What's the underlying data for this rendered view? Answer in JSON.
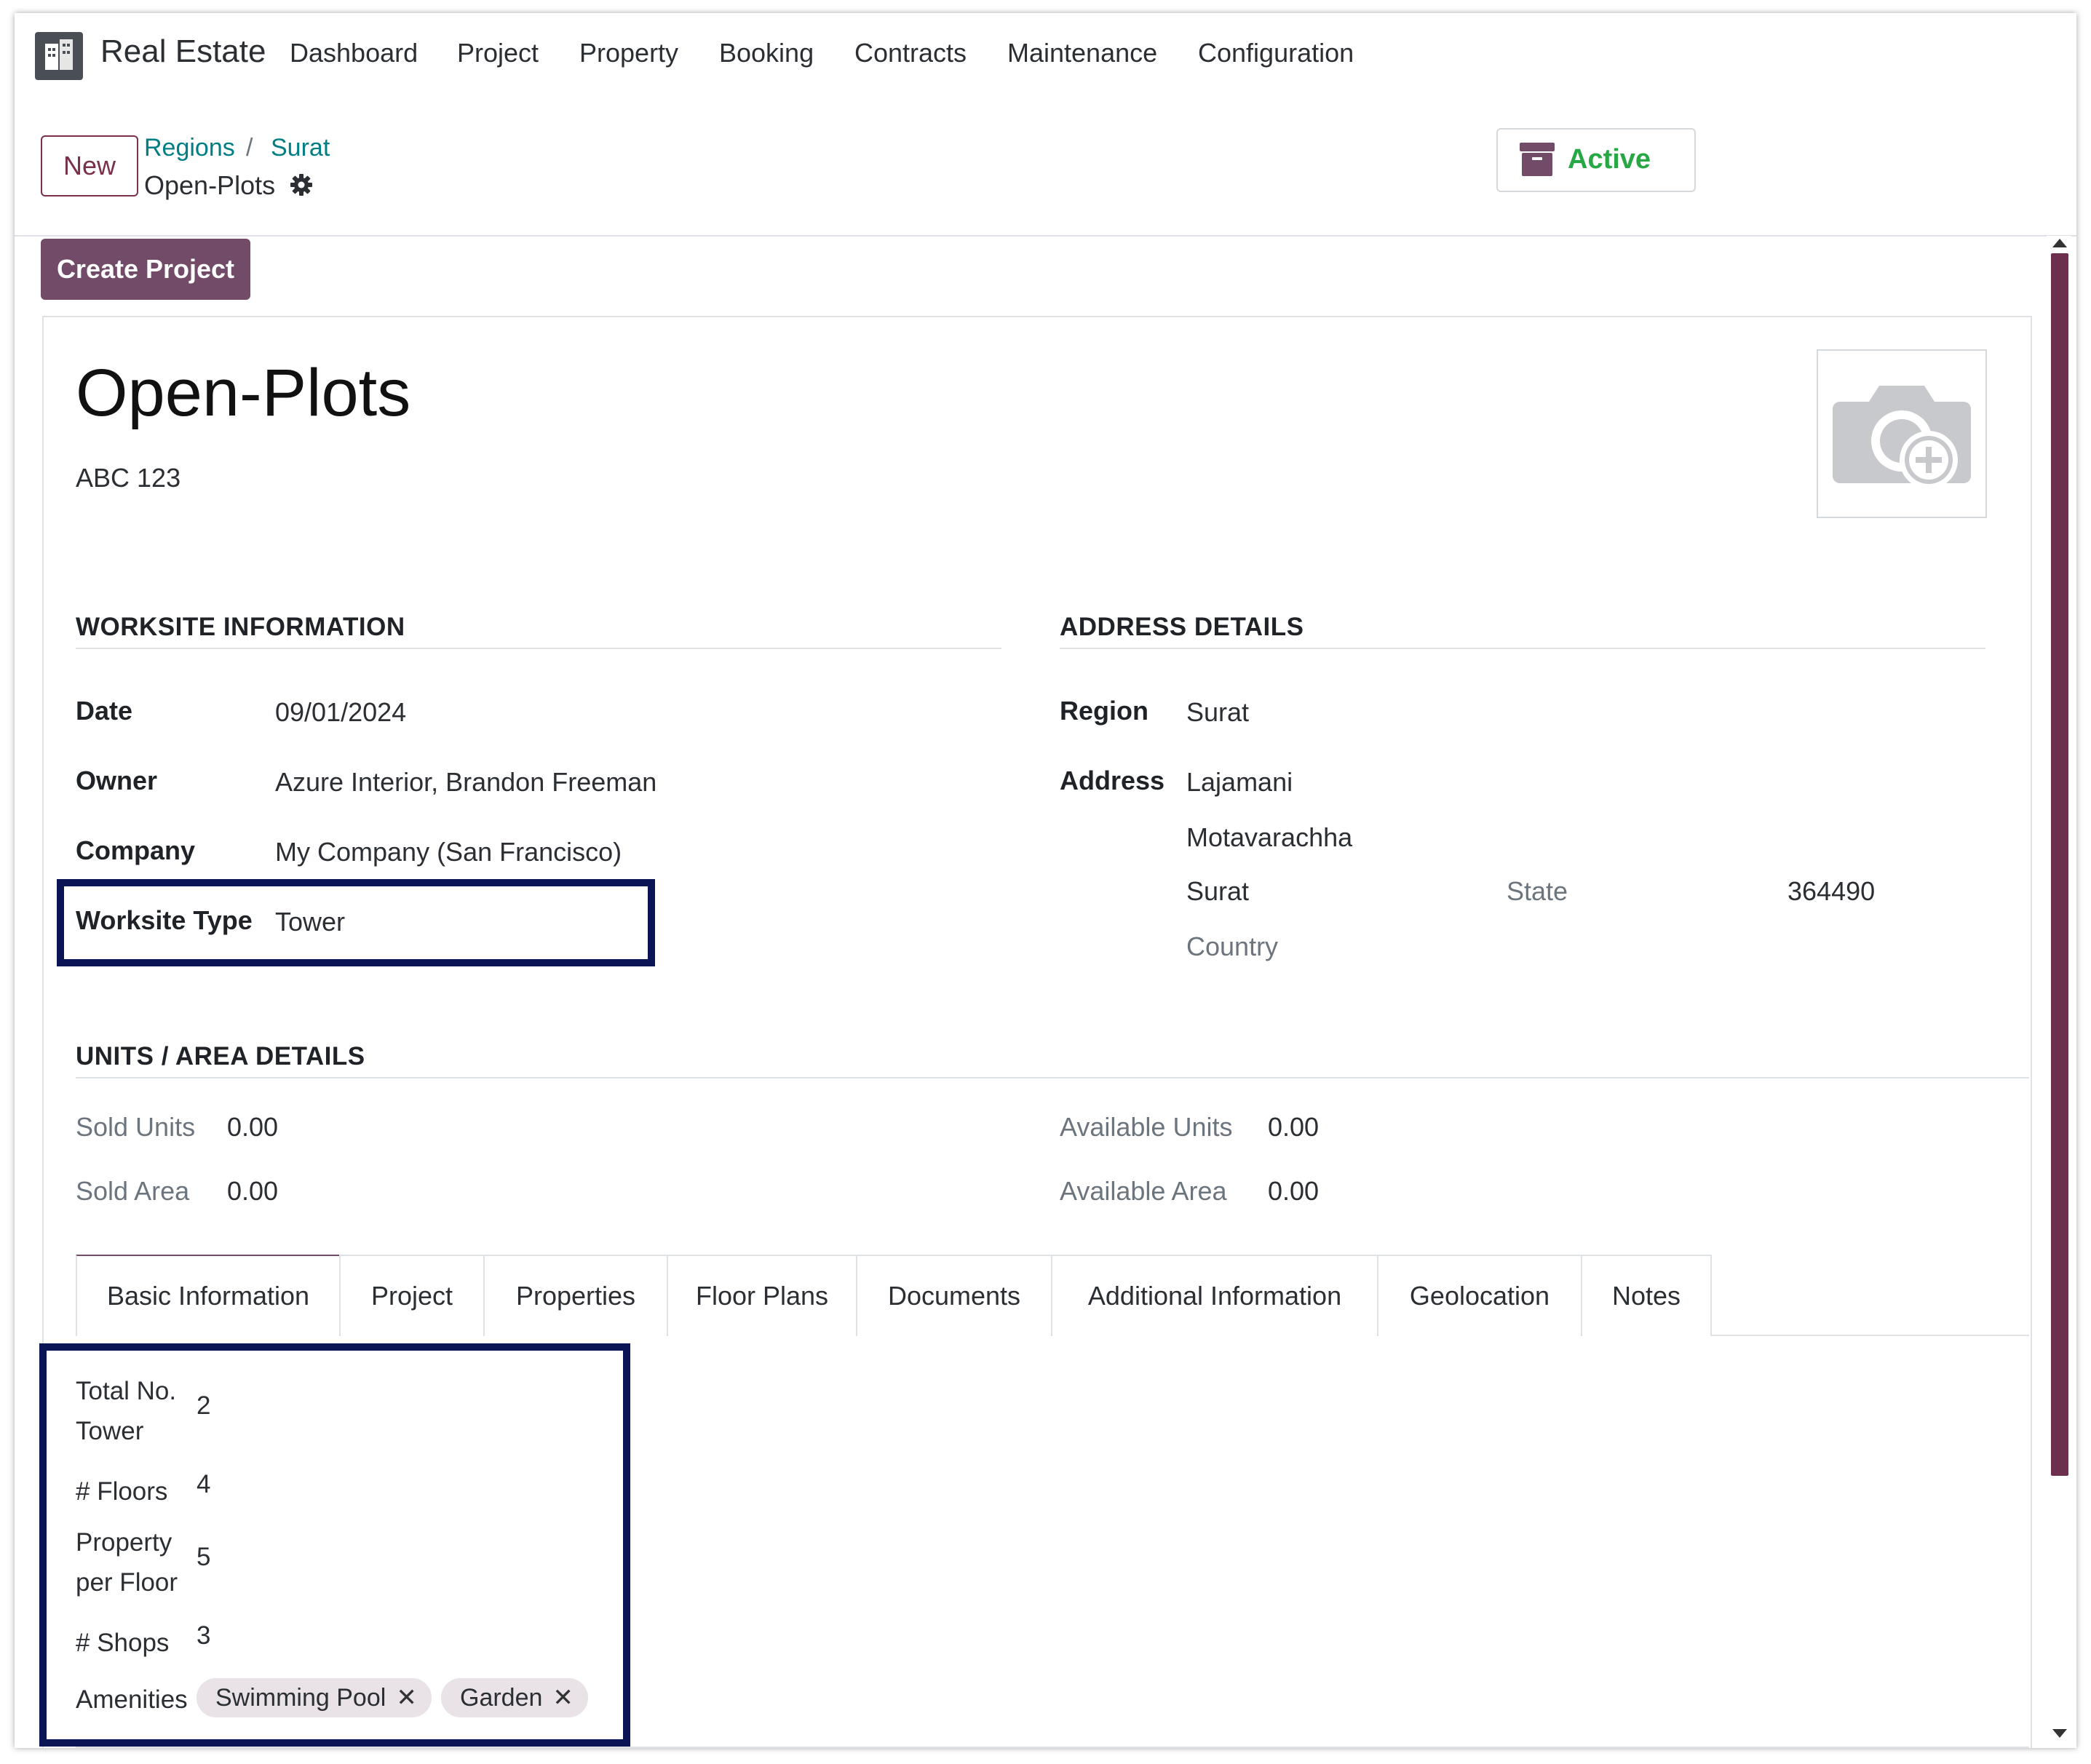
{
  "topnav": {
    "app_title": "Real Estate",
    "menu": [
      "Dashboard",
      "Project",
      "Property",
      "Booking",
      "Contracts",
      "Maintenance",
      "Configuration"
    ]
  },
  "control_panel": {
    "new_label": "New",
    "breadcrumbs": [
      "Regions",
      "Surat"
    ],
    "breadcrumb_sep": "/",
    "record_name": "Open-Plots",
    "status_label": "Active"
  },
  "actions": {
    "create_project": "Create Project"
  },
  "record": {
    "title": "Open-Plots",
    "reference": "ABC 123"
  },
  "worksite": {
    "section_title": "WORKSITE INFORMATION",
    "date_label": "Date",
    "date": "09/01/2024",
    "owner_label": "Owner",
    "owner": "Azure Interior, Brandon Freeman",
    "company_label": "Company",
    "company": "My Company (San Francisco)",
    "type_label": "Worksite Type",
    "type": "Tower"
  },
  "address": {
    "section_title": "ADDRESS DETAILS",
    "region_label": "Region",
    "region": "Surat",
    "address_label": "Address",
    "street": "Lajamani",
    "street2": "Motavarachha",
    "city": "Surat",
    "state_placeholder": "State",
    "zip": "364490",
    "country_placeholder": "Country"
  },
  "units": {
    "section_title": "UNITS / AREA DETAILS",
    "sold_units_label": "Sold Units",
    "sold_units": "0.00",
    "sold_area_label": "Sold Area",
    "sold_area": "0.00",
    "avail_units_label": "Available Units",
    "avail_units": "0.00",
    "avail_area_label": "Available Area",
    "avail_area": "0.00"
  },
  "tabs": [
    "Basic Information",
    "Project",
    "Properties",
    "Floor Plans",
    "Documents",
    "Additional Information",
    "Geolocation",
    "Notes"
  ],
  "basic_info": {
    "total_tower_label_1": "Total No.",
    "total_tower_label_2": "Tower",
    "total_tower": "2",
    "floors_label": "# Floors",
    "floors": "4",
    "ppf_label_1": "Property",
    "ppf_label_2": "per Floor",
    "ppf": "5",
    "shops_label": "# Shops",
    "shops": "3",
    "amenities_label": "Amenities",
    "amenities": [
      "Swimming Pool",
      "Garden"
    ]
  },
  "colors": {
    "brand": "#714b67",
    "link": "#017e84",
    "active": "#28a745",
    "highlight": "#0b1454"
  },
  "icons": [
    "building-logo-icon",
    "gear-icon",
    "archive-box-icon",
    "camera-add-icon",
    "remove-tag-icon"
  ]
}
